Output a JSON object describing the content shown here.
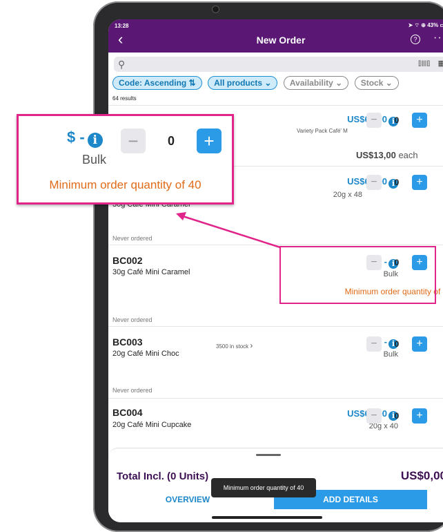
{
  "status_bar": {
    "time": "13:28",
    "right": "➤ ⌔ ⊕ 43% ▭"
  },
  "header": {
    "title": "New Order",
    "back_icon": "chevron-left-icon",
    "help_icon": "?",
    "more": "···"
  },
  "search": {
    "placeholder": "",
    "barcode_label": "[|||||]"
  },
  "filters": [
    "Code: Ascending ⇅",
    "All products ⌄",
    "Availability ⌄",
    "Stock ⌄"
  ],
  "results_count": "64 results",
  "products": [
    {
      "code": "",
      "name": "",
      "price": "US$65,00",
      "variant": "Variety Pack Café' M",
      "qty": "0",
      "each": "US$13,00",
      "each_suffix": "each"
    },
    {
      "code": "",
      "name": "30g Café Mini Caramel",
      "price": "US$65,00",
      "variant": "20g x 48",
      "qty": "0"
    },
    {
      "label": "Never ordered",
      "code": "BC002",
      "name": "30g Café Mini Caramel",
      "price": "$ -",
      "variant": "Bulk",
      "qty": "0",
      "note": "Minimum order quantity of 40"
    },
    {
      "label": "Never ordered",
      "code": "BC003",
      "name": "20g Café Mini Choc",
      "stock": "3500 in stock",
      "price": "$ -",
      "variant": "Bulk",
      "qty": "0"
    },
    {
      "label": "Never ordered",
      "code": "BC004",
      "name": "20g Café Mini Cupcake",
      "price": "US$65,00",
      "variant": "20g x 40",
      "qty": "0"
    }
  ],
  "zoom_callout": {
    "price": "$ -",
    "qty": "0",
    "variant": "Bulk",
    "note": "Minimum order quantity of 40"
  },
  "footer": {
    "total_label": "Total Incl. (0 Units)",
    "total_value": "US$0,00",
    "overview": "OVERVIEW",
    "add_details": "ADD DETAILS"
  },
  "toast": "Minimum order quantity of 40",
  "colors": {
    "header": "#5a1874",
    "accent": "#1c87c9",
    "button": "#2b9be8",
    "warning": "#e06b18",
    "highlight": "#e0248a"
  }
}
